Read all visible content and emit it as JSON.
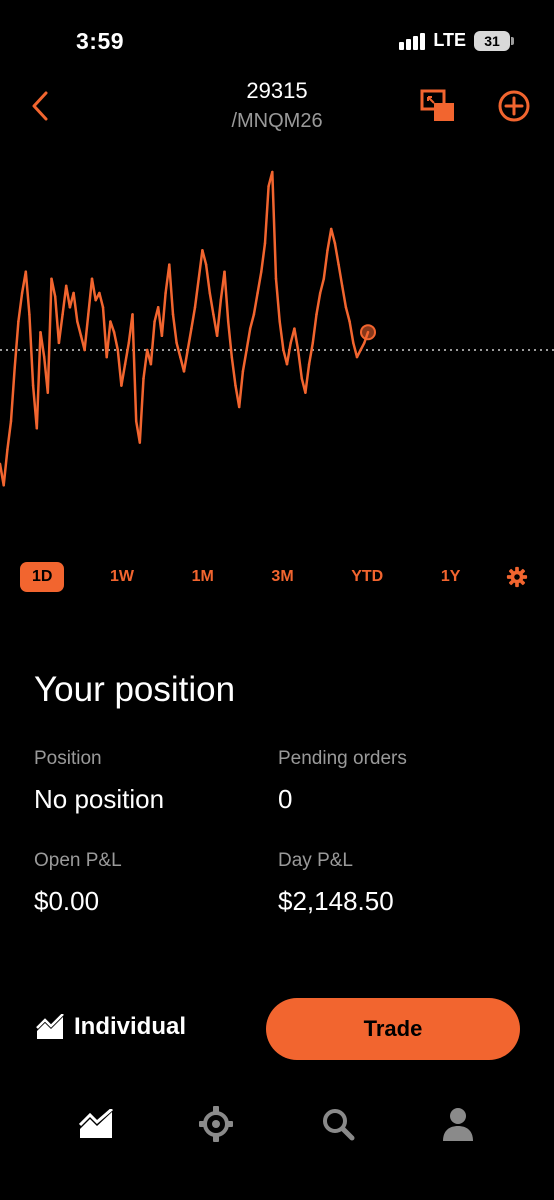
{
  "status": {
    "time": "3:59",
    "network": "LTE",
    "battery": "31"
  },
  "header": {
    "title": "29315",
    "subtitle": "/MNQM26",
    "icons": [
      "chevron-left-icon",
      "picture-in-picture-icon",
      "plus-circle-icon"
    ]
  },
  "colors": {
    "accent": "#f2652f",
    "background": "#000000",
    "muted": "#9a9a9a"
  },
  "chart_data": {
    "type": "line",
    "x": [
      0,
      1,
      2,
      3,
      4,
      5,
      6,
      7,
      8,
      9,
      10,
      11,
      12,
      13,
      14,
      15,
      16,
      17,
      18,
      19,
      20,
      21,
      22,
      23,
      24,
      25,
      26,
      27,
      28,
      29,
      30,
      31,
      32,
      33,
      34,
      35,
      36,
      37,
      38,
      39,
      40,
      41,
      42,
      43,
      44,
      45,
      46,
      47,
      48,
      49,
      50,
      51,
      52,
      53,
      54,
      55,
      56,
      57,
      58,
      59,
      60,
      61,
      62,
      63,
      64,
      65,
      66,
      67,
      68,
      69,
      70,
      71,
      72,
      73,
      74,
      75,
      76,
      77,
      78,
      79,
      80,
      81,
      82,
      83,
      84,
      85,
      86,
      87,
      88,
      89,
      90,
      91,
      92,
      93,
      94,
      95,
      96,
      97,
      98,
      99,
      100
    ],
    "values": [
      0.18,
      0.12,
      0.22,
      0.3,
      0.45,
      0.58,
      0.66,
      0.72,
      0.6,
      0.4,
      0.28,
      0.55,
      0.48,
      0.38,
      0.7,
      0.65,
      0.52,
      0.6,
      0.68,
      0.62,
      0.66,
      0.58,
      0.54,
      0.5,
      0.6,
      0.7,
      0.64,
      0.66,
      0.62,
      0.48,
      0.58,
      0.55,
      0.5,
      0.4,
      0.46,
      0.52,
      0.6,
      0.3,
      0.24,
      0.42,
      0.5,
      0.46,
      0.58,
      0.62,
      0.54,
      0.66,
      0.74,
      0.6,
      0.52,
      0.48,
      0.44,
      0.5,
      0.56,
      0.62,
      0.7,
      0.78,
      0.74,
      0.66,
      0.6,
      0.54,
      0.64,
      0.72,
      0.58,
      0.48,
      0.4,
      0.34,
      0.44,
      0.5,
      0.56,
      0.6,
      0.66,
      0.72,
      0.8,
      0.96,
      1.0,
      0.7,
      0.58,
      0.5,
      0.46,
      0.52,
      0.56,
      0.5,
      0.42,
      0.38,
      0.46,
      0.52,
      0.6,
      0.66,
      0.7,
      0.78,
      0.84,
      0.8,
      0.74,
      0.68,
      0.62,
      0.58,
      0.52,
      0.48,
      0.5,
      0.52,
      0.55
    ],
    "reference_line": 0.5,
    "ylim": [
      0,
      1
    ]
  },
  "ranges": {
    "d1": "1D",
    "w1": "1W",
    "m1": "1M",
    "m3": "3M",
    "ytd": "YTD",
    "y1": "1Y",
    "settings_icon": "gear-icon"
  },
  "position": {
    "title": "Your position",
    "position_label": "Position",
    "position_value": "No position",
    "pending_label": "Pending orders",
    "pending_value": "0",
    "open_pl_label": "Open P&L",
    "open_pl_value": "$0.00",
    "day_pl_label": "Day P&L",
    "day_pl_value": "$2,148.50"
  },
  "footer": {
    "account_label": "Individual",
    "trade_label": "Trade"
  },
  "nav": {
    "items": [
      "investing-icon",
      "crypto-icon",
      "search-icon",
      "account-icon"
    ]
  }
}
